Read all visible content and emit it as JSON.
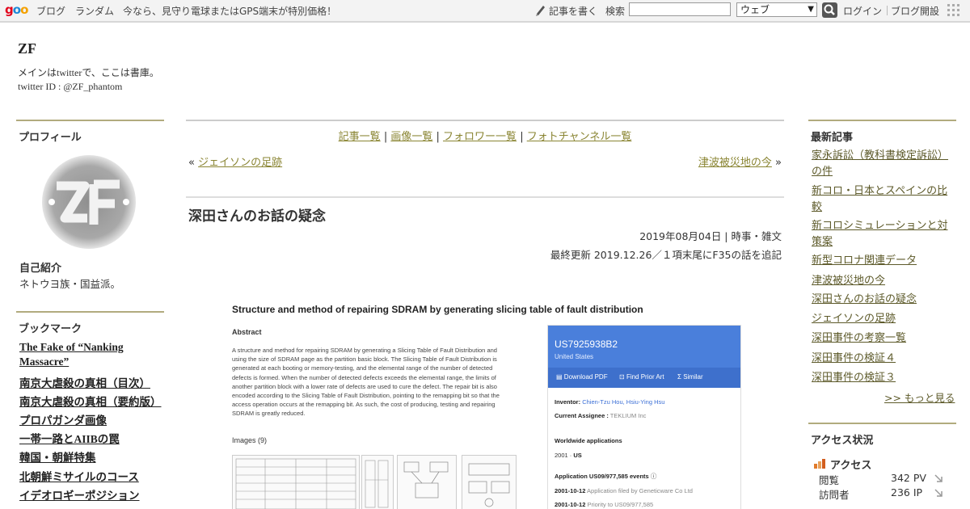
{
  "topbar": {
    "logo": "goo",
    "links": [
      "ブログ",
      "ランダム",
      "今なら、見守り電球またはGPS端末が特別価格！"
    ],
    "write_label": "記事を書く",
    "search_label": "検索",
    "search_value": "",
    "search_scope": "ウェブ",
    "login": "ログイン",
    "signup": "ブログ開設"
  },
  "header": {
    "title": "ZF",
    "desc_line1": "メインはtwitterで、ここは書庫。",
    "desc_line2": "twitter ID : @ZF_phantom"
  },
  "left": {
    "profile_heading": "プロフィール",
    "intro_heading": "自己紹介",
    "intro_text": "ネトウヨ族・国益派。",
    "bookmark_heading": "ブックマーク",
    "bookmarks": [
      "The Fake of “Nanking",
      "Massacre”",
      "南京大虐殺の真相（目次）",
      "南京大虐殺の真相（要約版）",
      "プロパガンダ画像",
      "一帯一路とAIIBの罠",
      "韓国・朝鮮特集",
      "北朝鮮ミサイルのコース",
      "イデオロギーポジション"
    ]
  },
  "center": {
    "nav": [
      "記事一覧",
      "画像一覧",
      "フォロワー一覧",
      "フォトチャンネル一覧"
    ],
    "nav_sep": "|",
    "prev_mark": "«",
    "prev_title": "ジェイソンの足跡",
    "next_title": "津波被災地の今",
    "next_mark": "»",
    "post_title": "深田さんのお話の疑念",
    "post_meta": "2019年08月04日 | 時事・雑文",
    "post_updated": "最終更新 2019.12.26／１項末尾にF35の話を追記"
  },
  "patent": {
    "title": "Structure and method of repairing SDRAM by generating slicing table of fault distribution",
    "abstract_heading": "Abstract",
    "abstract": "A structure and method for repairing SDRAM by generating a Slicing Table of Fault Distribution and using the size of SDRAM page as the partition basic block. The Slicing Table of Fault Distribution is generated at each booting or memory-testing, and the elemental range of the number of detected defects is formed. When the number of detected defects exceeds the elemental range, the limits of another partition block with a lower rate of defects are used to cure the defect. The repair bit is also encoded according to the Slicing Table of Fault Distribution, pointing to the remapping bit so that the access operation occurs at the remapping bit. As such, the cost of producing, testing and repairing SDRAM is greatly reduced.",
    "images_heading": "Images (9)",
    "number": "US7925938B2",
    "country": "United States",
    "actions": [
      "Download PDF",
      "Find Prior Art",
      "Similar"
    ],
    "inventor_label": "Inventor:",
    "inventor_value": "Chien-Tzu Hou, Hsiu-Ying Hsu",
    "assignee_label": "Current Assignee :",
    "assignee_value": "TEKLIUM Inc",
    "worldwide_label": "Worldwide applications",
    "worldwide_year": "2001",
    "worldwide_country": "US",
    "events_label": "Application US09/977,585 events",
    "events": [
      {
        "date": "2001-10-12",
        "text": "Application filed by Geneticware Co Ltd"
      },
      {
        "date": "2001-10-12",
        "text": "Priority to US09/977,585"
      }
    ]
  },
  "right": {
    "recent_heading": "最新記事",
    "recent": [
      "家永訴訟（教科書検定訴訟）の件",
      "新コロ・日本とスペインの比較",
      "新コロシミュレーションと対策案",
      "新型コロナ関連データ",
      "津波被災地の今",
      "深田さんのお話の疑念",
      "ジェイソンの足跡",
      "深田事件の考察一覧",
      "深田事件の検証４",
      "深田事件の検証３"
    ],
    "more": ">> もっと見る",
    "access_heading": "アクセス状況",
    "access_title": "アクセス",
    "views_label": "閲覧",
    "views_value": "342 PV",
    "visitors_label": "訪問者",
    "visitors_value": "236 IP"
  },
  "colors": {
    "accent_rule": "#b1ab7e",
    "link": "#8a8533",
    "patent_blue": "#4a7fdb"
  }
}
